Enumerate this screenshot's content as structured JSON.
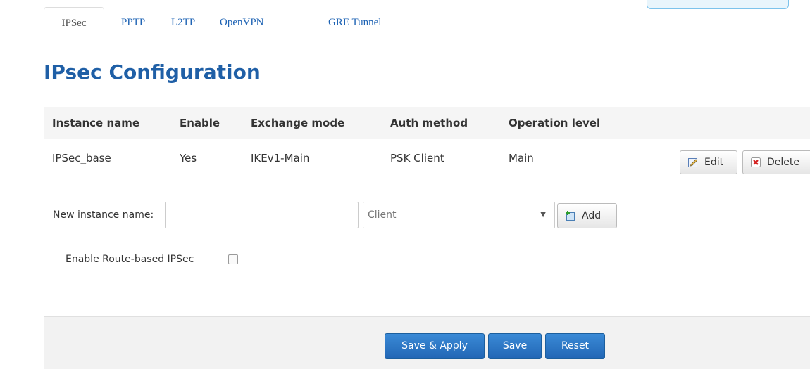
{
  "tabs": [
    {
      "label": "IPSec",
      "active": true
    },
    {
      "label": "PPTP",
      "active": false
    },
    {
      "label": "L2TP",
      "active": false
    },
    {
      "label": "OpenVPN",
      "active": false
    },
    {
      "label": "GRE Tunnel",
      "active": false
    }
  ],
  "page": {
    "title": "IPsec Configuration"
  },
  "table": {
    "headers": [
      "Instance name",
      "Enable",
      "Exchange mode",
      "Auth method",
      "Operation level"
    ],
    "rows": [
      {
        "instance_name": "IPSec_base",
        "enable": "Yes",
        "exchange_mode": "IKEv1-Main",
        "auth_method": "PSK Client",
        "operation_level": "Main",
        "edit_label": "Edit",
        "delete_label": "Delete"
      }
    ]
  },
  "new_instance": {
    "label": "New instance name:",
    "value": "",
    "placeholder": "",
    "type_selected": "Client",
    "add_label": "Add"
  },
  "route_based": {
    "label": "Enable Route-based IPSec",
    "checked": false
  },
  "footer": {
    "save_apply": "Save & Apply",
    "save": "Save",
    "reset": "Reset"
  },
  "colors": {
    "accent": "#1f5fa6",
    "link": "#1e63b4",
    "primary_button": "#2a72c3"
  },
  "icons": {
    "edit": "edit-icon",
    "delete": "delete-icon",
    "add": "add-icon"
  }
}
